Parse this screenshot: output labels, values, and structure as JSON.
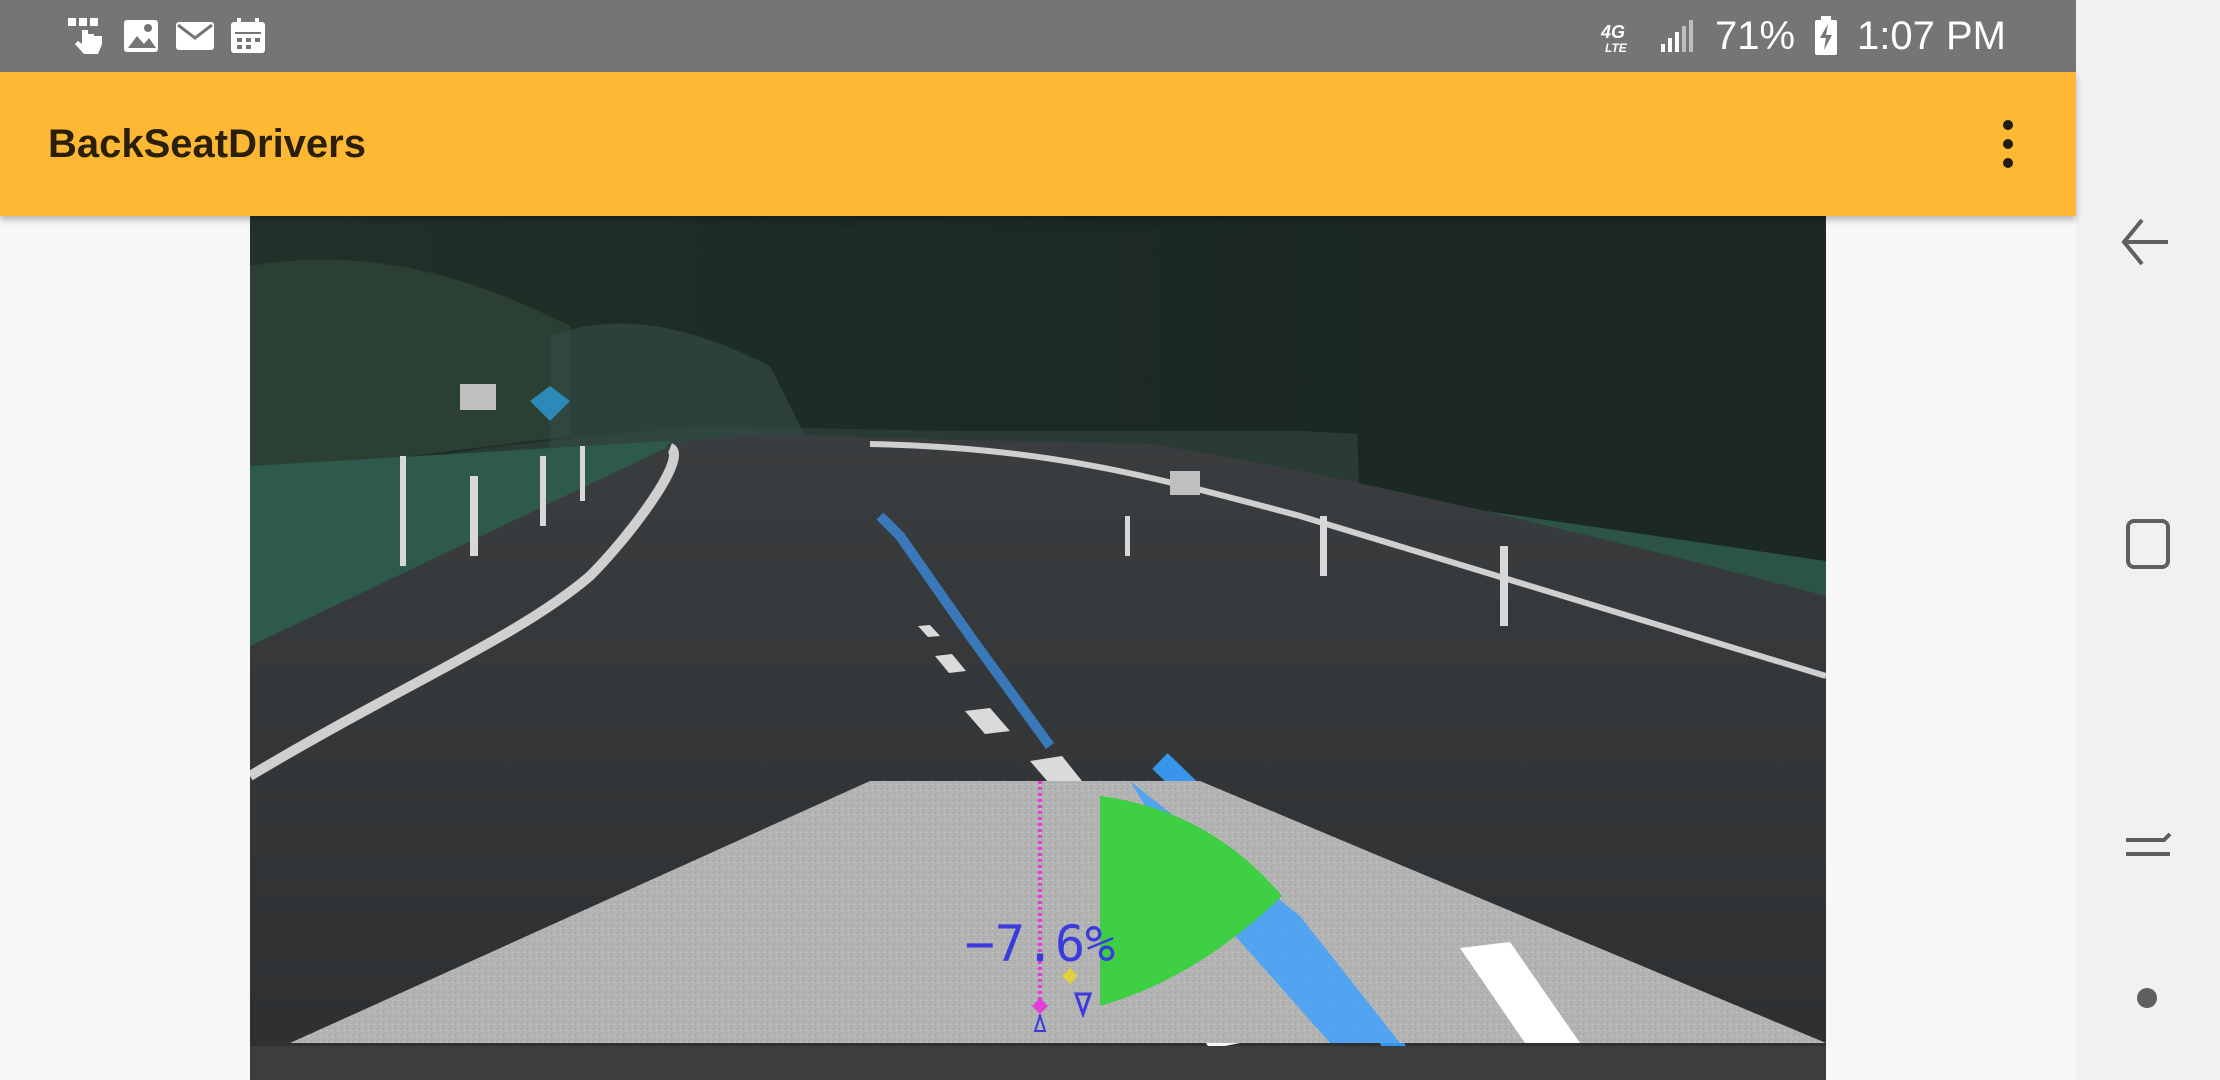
{
  "status_bar": {
    "left_icons": [
      "touch-hand-notification-icon",
      "gallery-image-icon",
      "email-icon",
      "calendar-icon"
    ],
    "network_label": "4G",
    "network_sub": "LTE",
    "battery_percent": "71%",
    "time": "1:07 PM"
  },
  "app_bar": {
    "title": "BackSeatDrivers",
    "menu_icon": "more-vert-icon"
  },
  "camera": {
    "offset_readout": "−7.6%",
    "colors": {
      "lane_highlight": "#3aa0ff",
      "steering_fan": "#3fcf45",
      "overlay_text": "#3a3adf",
      "center_marker": "#e040d8",
      "side_marker": "#e0d040",
      "warp_region": "#b8b8b8"
    }
  },
  "nav_bar": {
    "buttons": [
      "back-icon",
      "recents-icon",
      "home-icon",
      "menu-dot-icon"
    ]
  },
  "colors": {
    "status_bar_bg": "#757575",
    "app_bar_bg": "#ffb834",
    "page_bg": "#f7f7f7",
    "nav_bar_bg": "#f1f1f1"
  }
}
